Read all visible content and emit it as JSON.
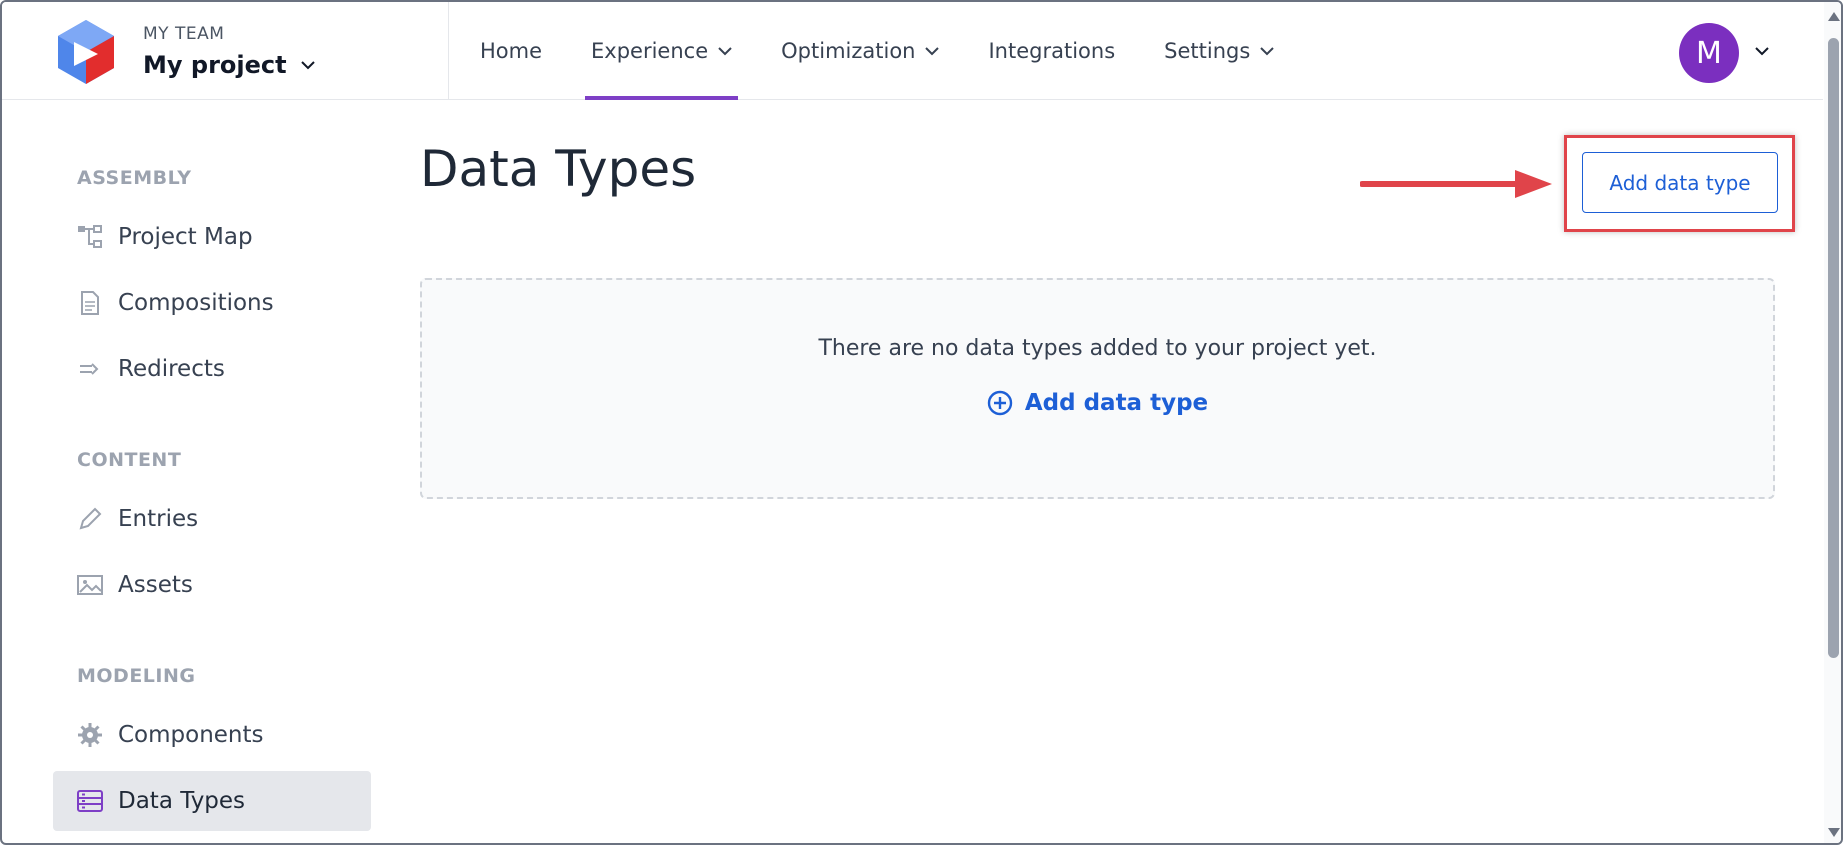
{
  "header": {
    "team_label": "MY TEAM",
    "project_name": "My project",
    "nav": [
      {
        "label": "Home"
      },
      {
        "label": "Experience"
      },
      {
        "label": "Optimization"
      },
      {
        "label": "Integrations"
      },
      {
        "label": "Settings"
      }
    ],
    "active_nav": "Experience",
    "avatar_initial": "M"
  },
  "sidebar": {
    "sections": [
      {
        "title": "ASSEMBLY",
        "items": [
          {
            "label": "Project Map",
            "icon": "project-map-icon"
          },
          {
            "label": "Compositions",
            "icon": "document-icon"
          },
          {
            "label": "Redirects",
            "icon": "redirect-icon"
          }
        ]
      },
      {
        "title": "CONTENT",
        "items": [
          {
            "label": "Entries",
            "icon": "pencil-icon"
          },
          {
            "label": "Assets",
            "icon": "image-icon"
          }
        ]
      },
      {
        "title": "MODELING",
        "items": [
          {
            "label": "Components",
            "icon": "gear-icon"
          },
          {
            "label": "Data Types",
            "icon": "data-types-icon"
          }
        ]
      }
    ],
    "active_item": "Data Types"
  },
  "main": {
    "title": "Data Types",
    "add_button_label": "Add data type",
    "empty_message": "There are no data types added to your project yet.",
    "empty_add_label": "Add data type"
  },
  "colors": {
    "accent": "#1d5fd6",
    "nav_underline": "#7e3fc6",
    "avatar": "#7b2fbf",
    "annotation": "#e0444a"
  }
}
